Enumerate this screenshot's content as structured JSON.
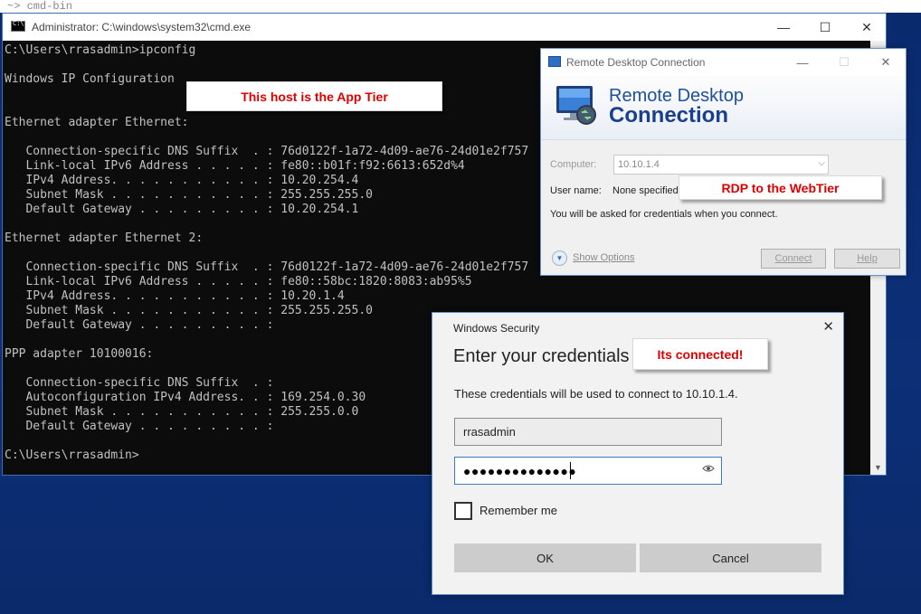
{
  "desktop": {
    "top_text": "~> cmd-bin"
  },
  "cmd": {
    "title": "Administrator: C:\\windows\\system32\\cmd.exe",
    "controls": {
      "minimize": "—",
      "maximize": "☐",
      "close": "✕"
    },
    "lines": [
      "C:\\Users\\rrasadmin>ipconfig",
      "",
      "Windows IP Configuration",
      "",
      "",
      "Ethernet adapter Ethernet:",
      "",
      "   Connection-specific DNS Suffix  . : 76d0122f-1a72-4d09-ae76-24d01e2f757",
      "   Link-local IPv6 Address . . . . . : fe80::b01f:f92:6613:652d%4",
      "   IPv4 Address. . . . . . . . . . . : 10.20.254.4",
      "   Subnet Mask . . . . . . . . . . . : 255.255.255.0",
      "   Default Gateway . . . . . . . . . : 10.20.254.1",
      "",
      "Ethernet adapter Ethernet 2:",
      "",
      "   Connection-specific DNS Suffix  . : 76d0122f-1a72-4d09-ae76-24d01e2f757",
      "   Link-local IPv6 Address . . . . . : fe80::58bc:1820:8083:ab95%5",
      "   IPv4 Address. . . . . . . . . . . : 10.20.1.4",
      "   Subnet Mask . . . . . . . . . . . : 255.255.255.0",
      "   Default Gateway . . . . . . . . . :",
      "",
      "PPP adapter 10100016:",
      "",
      "   Connection-specific DNS Suffix  . :",
      "   Autoconfiguration IPv4 Address. . : 169.254.0.30",
      "   Subnet Mask . . . . . . . . . . . : 255.255.0.0",
      "   Default Gateway . . . . . . . . . :",
      "",
      "C:\\Users\\rrasadmin>"
    ]
  },
  "callouts": {
    "app_tier": "This host is the App Tier",
    "web_tier": "RDP to the WebTier",
    "connected": "Its connected!"
  },
  "rdp": {
    "title": "Remote Desktop Connection",
    "controls": {
      "minimize": "—",
      "maximize": "☐",
      "close": "✕"
    },
    "heading_line1": "Remote Desktop",
    "heading_line2": "Connection",
    "computer_label": "Computer:",
    "computer_value": "10.10.1.4",
    "username_label": "User name:",
    "username_value": "None specified",
    "info": "You will be asked for credentials when you connect.",
    "show_options": "Show Options",
    "connect_button": "Connect",
    "help_button": "Help"
  },
  "security": {
    "title": "Windows Security",
    "close": "✕",
    "heading": "Enter your credentials",
    "description": "These credentials will be used to connect to 10.10.1.4.",
    "username": "rrasadmin",
    "password_mask": "●●●●●●●●●●●●●●",
    "remember_label": "Remember me",
    "ok_button": "OK",
    "cancel_button": "Cancel"
  },
  "colors": {
    "callout_text": "#e00000",
    "rdp_heading": "#1a3f8e",
    "console_bg": "#0c0c0c"
  }
}
